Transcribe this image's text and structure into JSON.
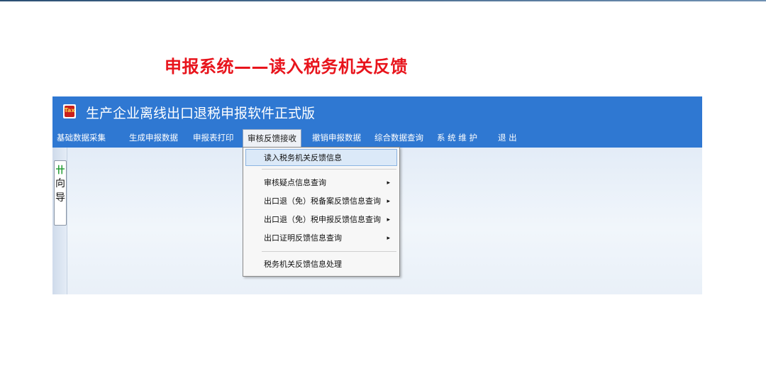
{
  "slide": {
    "title": "申报系统——读入税务机关反馈"
  },
  "app": {
    "title": "生产企业离线出口退税申报软件正式版",
    "icon": "app-logo-icon",
    "icon_text": "Tax"
  },
  "menu": {
    "items": [
      {
        "label": "基础数据采集"
      },
      {
        "label": "生成申报数据"
      },
      {
        "label": "申报表打印"
      },
      {
        "label": "审核反馈接收",
        "active": true
      },
      {
        "label": "撤销申报数据"
      },
      {
        "label": "综合数据查询"
      },
      {
        "label": "系 统 维 护"
      },
      {
        "label": "退  出"
      }
    ]
  },
  "dropdown": {
    "items": [
      {
        "label": "读入税务机关反馈信息",
        "selected": true
      },
      {
        "label": "审核疑点信息查询",
        "submenu": true
      },
      {
        "label": "出口退（免）税备案反馈信息查询",
        "submenu": true
      },
      {
        "label": "出口退（免）税申报反馈信息查询",
        "submenu": true
      },
      {
        "label": "出口证明反馈信息查询",
        "submenu": true
      },
      {
        "label": "税务机关反馈信息处理"
      }
    ],
    "arrow": "▸"
  },
  "guide": {
    "glyph": "卄",
    "label": "向导"
  },
  "colors": {
    "title_red": "#e8141c",
    "titlebar_blue": "#2f78d2",
    "selection": "#dbe9f8"
  }
}
